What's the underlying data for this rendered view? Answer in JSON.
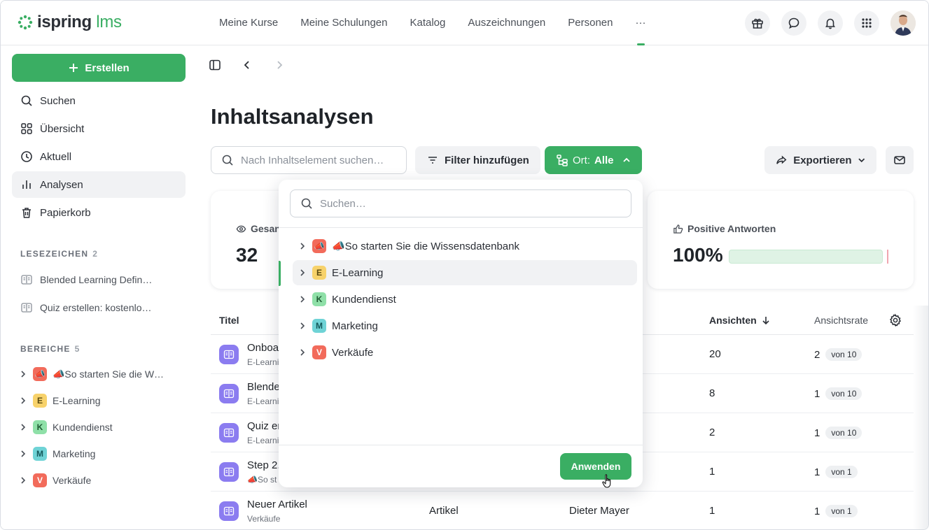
{
  "app": {
    "logo_main": "ispring",
    "logo_accent": "lms",
    "accent_color": "#3aae63"
  },
  "topnav": {
    "items": [
      "Meine Kurse",
      "Meine Schulungen",
      "Katalog",
      "Auszeichnungen",
      "Personen",
      "···"
    ]
  },
  "sidebar": {
    "create_label": "Erstellen",
    "items": [
      "Suchen",
      "Übersicht",
      "Aktuell",
      "Analysen",
      "Papierkorb"
    ],
    "bookmarks_head": "LESEZEICHEN",
    "bookmarks_count": "2",
    "bookmarks": [
      "Blended Learning Defin…",
      "Quiz erstellen: kostenlo…"
    ],
    "areas_head": "BEREICHE",
    "areas_count": "5",
    "areas": [
      {
        "badge": "📣",
        "label": "📣So starten Sie die W…",
        "color": "#f26b5b"
      },
      {
        "badge": "E",
        "label": "E-Learning",
        "color": "#f7d26b"
      },
      {
        "badge": "K",
        "label": "Kundendienst",
        "color": "#8fe0a8"
      },
      {
        "badge": "M",
        "label": "Marketing",
        "color": "#6fd3d6"
      },
      {
        "badge": "V",
        "label": "Verkäufe",
        "color": "#f26b5b"
      }
    ]
  },
  "main": {
    "title": "Inhaltsanalysen",
    "search_placeholder": "Nach Inhaltselement suchen…",
    "filter_label": "Filter hinzufügen",
    "location_label": "Ort:",
    "location_value": "Alle",
    "export_label": "Exportieren",
    "card_views_label": "Gesan",
    "card_views_value": "32",
    "card_positive_label": "Positive Antworten",
    "card_positive_value": "100%",
    "positive_fraction": 1.0
  },
  "table": {
    "headers": {
      "title": "Titel",
      "views": "Ansichten",
      "rate": "Ansichtsrate"
    },
    "rows": [
      {
        "title": "Onboa",
        "sub": "E-Learni",
        "type": "",
        "author": "",
        "views": "20",
        "rate": "2",
        "of": "von 10"
      },
      {
        "title": "Blende",
        "sub": "E-Learni",
        "type": "",
        "author": "",
        "views": "8",
        "rate": "1",
        "of": "von 10"
      },
      {
        "title": "Quiz er",
        "sub": "E-Learni",
        "type": "",
        "author": "",
        "views": "2",
        "rate": "1",
        "of": "von 10"
      },
      {
        "title": "Step 2.",
        "sub": "📣So st",
        "type": "",
        "author": "",
        "views": "1",
        "rate": "1",
        "of": "von 1"
      },
      {
        "title": "Neuer Artikel",
        "sub": "Verkäufe",
        "type": "Artikel",
        "author": "Dieter Mayer",
        "views": "1",
        "rate": "1",
        "of": "von 1"
      }
    ]
  },
  "dropdown": {
    "search_placeholder": "Suchen…",
    "items": [
      {
        "badge": "📣",
        "label": "📣So starten Sie die Wissensdatenbank",
        "color": "#f26b5b"
      },
      {
        "badge": "E",
        "label": "E-Learning",
        "color": "#f7d26b"
      },
      {
        "badge": "K",
        "label": "Kundendienst",
        "color": "#8fe0a8"
      },
      {
        "badge": "M",
        "label": "Marketing",
        "color": "#6fd3d6"
      },
      {
        "badge": "V",
        "label": "Verkäufe",
        "color": "#f26b5b"
      }
    ],
    "apply_label": "Anwenden"
  }
}
